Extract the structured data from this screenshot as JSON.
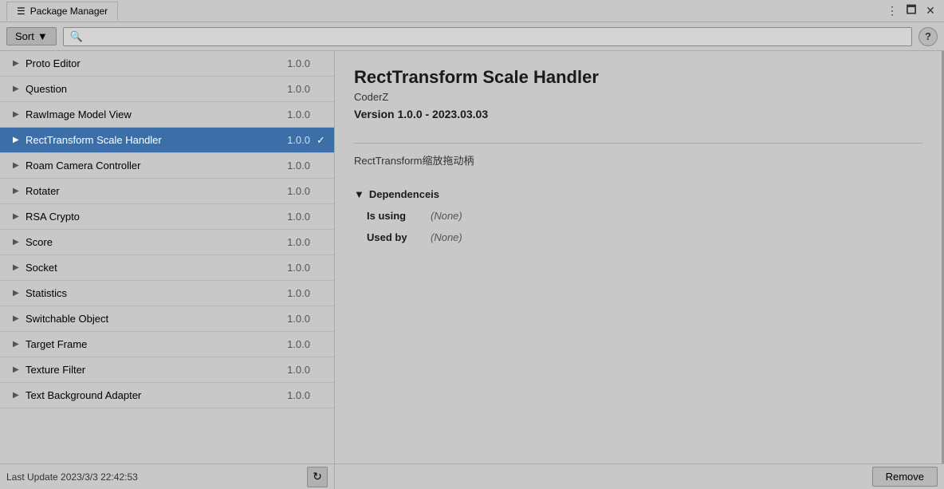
{
  "titlebar": {
    "icon": "☰",
    "title": "Package Manager",
    "dots_icon": "⋮",
    "minimize_icon": "🗖",
    "close_icon": "✕"
  },
  "toolbar": {
    "sort_label": "Sort",
    "sort_arrow": "▼",
    "search_placeholder": "🔍",
    "help_label": "?"
  },
  "packages": [
    {
      "name": "Proto Editor",
      "version": "1.0.0",
      "selected": false,
      "checked": false
    },
    {
      "name": "Question",
      "version": "1.0.0",
      "selected": false,
      "checked": false
    },
    {
      "name": "RawImage Model View",
      "version": "1.0.0",
      "selected": false,
      "checked": false
    },
    {
      "name": "RectTransform Scale Handler",
      "version": "1.0.0",
      "selected": true,
      "checked": true
    },
    {
      "name": "Roam Camera Controller",
      "version": "1.0.0",
      "selected": false,
      "checked": false
    },
    {
      "name": "Rotater",
      "version": "1.0.0",
      "selected": false,
      "checked": false
    },
    {
      "name": "RSA Crypto",
      "version": "1.0.0",
      "selected": false,
      "checked": false
    },
    {
      "name": "Score",
      "version": "1.0.0",
      "selected": false,
      "checked": false
    },
    {
      "name": "Socket",
      "version": "1.0.0",
      "selected": false,
      "checked": false
    },
    {
      "name": "Statistics",
      "version": "1.0.0",
      "selected": false,
      "checked": false
    },
    {
      "name": "Switchable Object",
      "version": "1.0.0",
      "selected": false,
      "checked": false
    },
    {
      "name": "Target Frame",
      "version": "1.0.0",
      "selected": false,
      "checked": false
    },
    {
      "name": "Texture Filter",
      "version": "1.0.0",
      "selected": false,
      "checked": false
    },
    {
      "name": "Text Background Adapter",
      "version": "1.0.0",
      "selected": false,
      "checked": false
    }
  ],
  "status": {
    "last_update_label": "Last Update",
    "last_update_value": "2023/3/3 22:42:53",
    "refresh_icon": "↻"
  },
  "detail": {
    "title": "RectTransform Scale Handler",
    "author": "CoderZ",
    "version": "Version 1.0.0 - 2023.03.03",
    "description": "RectTransform缩放拖动柄",
    "dependencies_header": "Dependenceis",
    "dep_arrow": "▼",
    "is_using_label": "Is using",
    "is_using_value": "(None)",
    "used_by_label": "Used by",
    "used_by_value": "(None)"
  },
  "bottom": {
    "remove_label": "Remove"
  }
}
